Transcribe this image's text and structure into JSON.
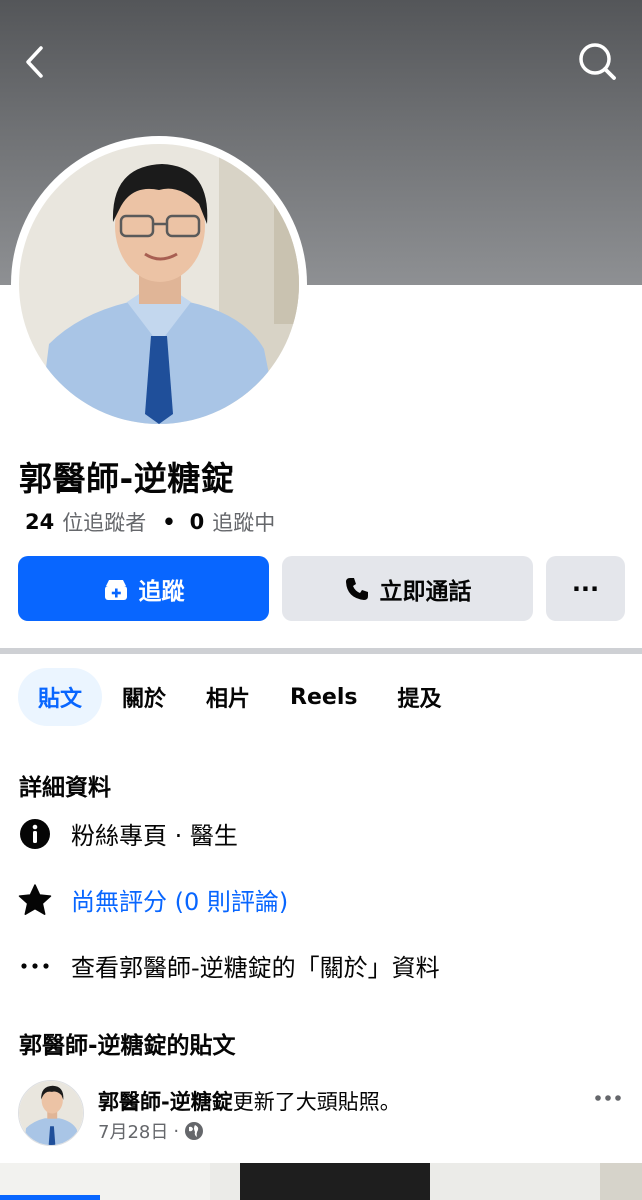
{
  "profile": {
    "name": "郭醫師-逆糖錠",
    "followers_count": "24",
    "followers_label": "位追蹤者",
    "following_count": "0",
    "following_label": "追蹤中"
  },
  "actions": {
    "follow_label": "追蹤",
    "call_label": "立即通話",
    "more_label": "···"
  },
  "tabs": [
    {
      "label": "貼文",
      "active": true
    },
    {
      "label": "關於",
      "active": false
    },
    {
      "label": "相片",
      "active": false
    },
    {
      "label": "Reels",
      "active": false
    },
    {
      "label": "提及",
      "active": false
    }
  ],
  "details": {
    "title": "詳細資料",
    "category": "粉絲專頁 · 醫生",
    "rating": "尚無評分 (0 則評論)",
    "about_link": "查看郭醫師-逆糖錠的「關於」資料"
  },
  "posts": {
    "title": "郭醫師-逆糖錠的貼文",
    "first": {
      "author": "郭醫師-逆糖錠",
      "action": "更新了大頭貼照。",
      "date": "7月28日",
      "separator": "·"
    }
  },
  "colors": {
    "accent": "#0866ff",
    "button_gray": "#e4e6eb",
    "secondary_text": "#65676b"
  }
}
